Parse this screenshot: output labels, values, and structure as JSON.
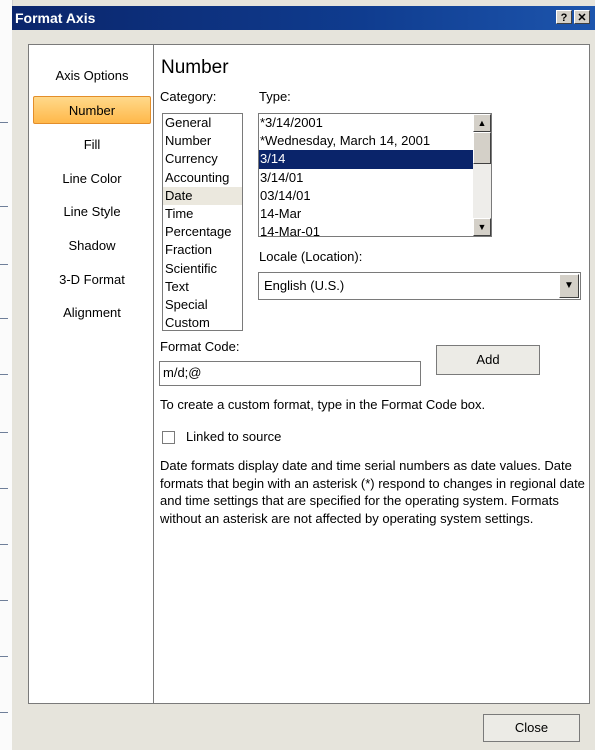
{
  "window": {
    "title": "Format Axis",
    "help_label": "?",
    "close_label": "✕"
  },
  "nav": {
    "items": [
      {
        "label": "Axis Options",
        "selected": false
      },
      {
        "label": "Number",
        "selected": true
      },
      {
        "label": "Fill",
        "selected": false
      },
      {
        "label": "Line Color",
        "selected": false
      },
      {
        "label": "Line Style",
        "selected": false
      },
      {
        "label": "Shadow",
        "selected": false
      },
      {
        "label": "3-D Format",
        "selected": false
      },
      {
        "label": "Alignment",
        "selected": false
      }
    ]
  },
  "panel": {
    "title": "Number",
    "category_label": "Category:",
    "categories": [
      "General",
      "Number",
      "Currency",
      "Accounting",
      "Date",
      "Time",
      "Percentage",
      "Fraction",
      "Scientific",
      "Text",
      "Special",
      "Custom"
    ],
    "selected_category": "Date",
    "type_label": "Type:",
    "types": [
      "*3/14/2001",
      "*Wednesday, March 14, 2001",
      "3/14",
      "3/14/01",
      "03/14/01",
      "14-Mar",
      "14-Mar-01"
    ],
    "selected_type": "3/14",
    "locale_label": "Locale (Location):",
    "locale_value": "English (U.S.)",
    "format_code_label": "Format Code:",
    "format_code_value": "m/d;@",
    "add_label": "Add",
    "custom_hint": "To create a custom format, type in the Format Code box.",
    "linked_label": "Linked to source",
    "linked_checked": false,
    "description": "Date formats display date and time serial numbers as date values.  Date formats that begin with an asterisk (*) respond to changes in regional date and time settings that are specified for the operating system. Formats without an asterisk are not affected by operating system settings."
  },
  "footer": {
    "close_label": "Close"
  },
  "icons": {
    "scroll_up": "▲",
    "scroll_down": "▼",
    "dropdown": "▼"
  },
  "colors": {
    "title_bar": "#0b256b",
    "selected_type_bg": "#0a246a",
    "nav_selected": "#ffb84a"
  }
}
